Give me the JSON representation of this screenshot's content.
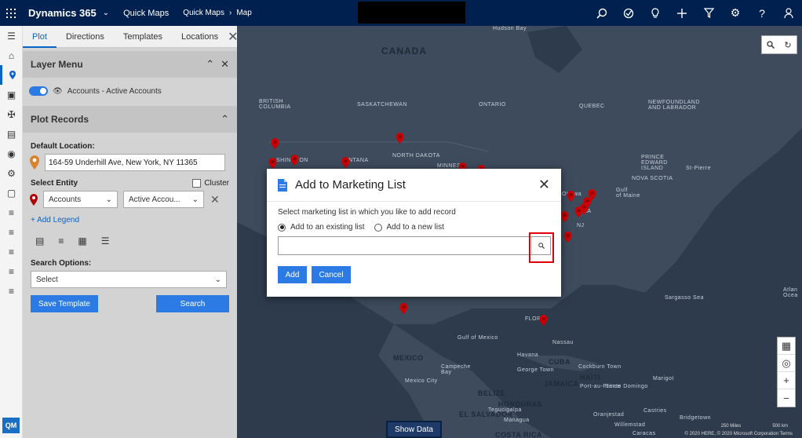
{
  "topbar": {
    "brand": "Dynamics 365",
    "app_name": "Quick Maps",
    "breadcrumb": [
      "Quick Maps",
      "Map"
    ],
    "bg_color": "#002050"
  },
  "rail": {
    "icons": [
      "menu-icon",
      "home-icon",
      "map-pin-icon",
      "map-marker-icon",
      "route-icon",
      "document-icon",
      "location-icon",
      "gear-icon",
      "monitor-icon",
      "layers-icon",
      "layers-icon",
      "layers-icon",
      "layers-icon",
      "layers-icon"
    ],
    "badge": "QM"
  },
  "panel": {
    "tabs": [
      "Plot",
      "Directions",
      "Templates",
      "Locations"
    ],
    "layer_menu": {
      "title": "Layer Menu",
      "layer_label": "Accounts - Active Accounts"
    },
    "plot_records": {
      "title": "Plot Records",
      "default_location_label": "Default Location:",
      "default_location_value": "164-59 Underhill Ave, New York, NY 11365",
      "select_entity_label": "Select Entity",
      "cluster_label": "Cluster",
      "entity_value": "Accounts",
      "view_value": "Active Accou...",
      "add_legend": "+ Add Legend",
      "search_options_label": "Search Options:",
      "search_option_value": "Select",
      "save_template": "Save Template",
      "search": "Search"
    }
  },
  "map": {
    "labels": {
      "canada": "CANADA",
      "hudson_bay": "Hudson Bay",
      "british_columbia": "BRITISH\nCOLUMBIA",
      "saskatchewan": "SASKATCHEWAN",
      "ontario": "ONTARIO",
      "quebec": "QUEBEC",
      "newfoundland": "NEWFOUNDLAND\nAND LABRADOR",
      "north_dakota": "NORTH DAKOTA",
      "montana": "ONTANA",
      "minnesota": "MINNES",
      "washington": "SHINGTON",
      "ottawa": "Ottawa",
      "gulf_of_maine": "Gulf\nof Maine",
      "nova_scotia": "NOVA SCOTIA",
      "prince_edward": "PRINCE\nEDWARD\nISLAND",
      "st_pierre": "St-Pierre",
      "nj": "NJ",
      "sargasso": "Sargasso Sea",
      "atlantic": "Atlan\nOcea",
      "gulf_mexico": "Gulf of Mexico",
      "mexico": "MEXICO",
      "mexico_city": "Mexico City",
      "campeche": "Campeche\nBay",
      "havana": "Havana",
      "cuba": "CUBA",
      "george_town": "George Town",
      "nassau": "Nassau",
      "cockburn": "Cockburn Town",
      "jamaica": "JAMAICA",
      "haiti": "HAITI",
      "port_au_prince": "Port-au-Prince",
      "santo_domingo": "Santo Domingo",
      "marigot": "Marigot",
      "belize": "BELIZE",
      "el_salvador": "EL SALVADOR",
      "tegucigalpa": "Tegucigalpa",
      "honduras": "HONDURAS",
      "costa_rica": "COSTA RICA",
      "managua": "Managua",
      "oranjestad": "Oranjestad",
      "bridgetown": "Bridgetown",
      "willemstad": "Willemstad",
      "castries": "Castries",
      "caracas": "Caracas",
      "flor": "FLOR",
      "ma": "MA"
    },
    "show_data": "Show Data",
    "scale": [
      "250 Miles",
      "500 km"
    ],
    "attribution": "© 2020 HERE, © 2020 Microsoft Corporation  Terms"
  },
  "dialog": {
    "title": "Add to Marketing List",
    "prompt": "Select marketing list in which you like to add record",
    "option_existing": "Add to an existing list",
    "option_new": "Add to a new list",
    "lookup_value": "",
    "add": "Add",
    "cancel": "Cancel",
    "accent": "#2c7be5",
    "highlight_color": "#e0000a"
  }
}
